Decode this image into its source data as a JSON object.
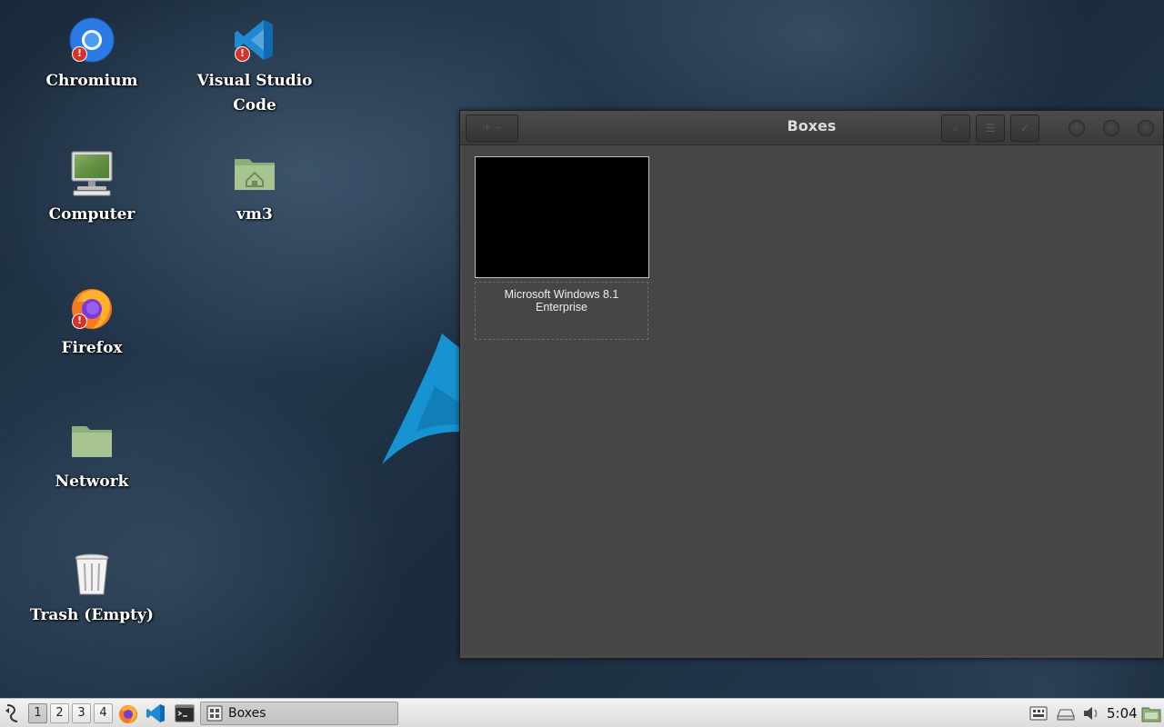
{
  "desktop": {
    "icons": [
      {
        "label": "Chromium",
        "icon": "chromium-icon"
      },
      {
        "label": "Visual Studio Code",
        "icon": "vscode-icon"
      },
      {
        "label": "Computer",
        "icon": "computer-icon"
      },
      {
        "label": "vm3",
        "icon": "home-folder-icon"
      },
      {
        "label": "Firefox",
        "icon": "firefox-icon"
      },
      {
        "label": "Network",
        "icon": "network-folder-icon"
      },
      {
        "label": "Trash (Empty)",
        "icon": "trash-icon"
      }
    ],
    "warning_badge": "!"
  },
  "window": {
    "title": "Boxes",
    "new_button_label": "+ –",
    "vm_items": [
      {
        "name": "Microsoft Windows 8.1 Enterprise"
      }
    ]
  },
  "taskbar": {
    "workspaces": [
      "1",
      "2",
      "3",
      "4"
    ],
    "active_workspace": "1",
    "task_label": "Boxes",
    "clock": "5:04"
  },
  "colors": {
    "window_bg": "#4a4a4a",
    "taskbar_bg": "#e6e6e6",
    "arch_blue": "#1793d1"
  }
}
